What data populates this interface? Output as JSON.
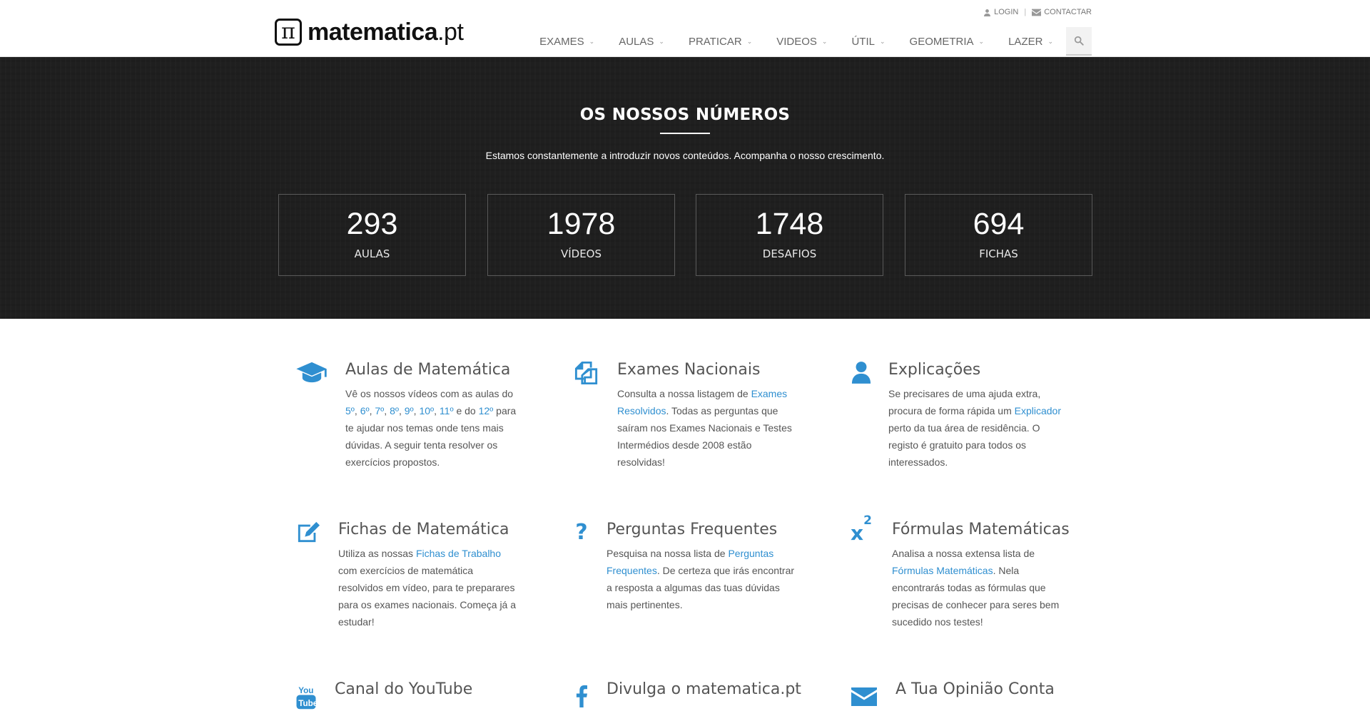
{
  "header": {
    "logo_symbol": "π",
    "logo_brand": "matematica",
    "logo_tld": ".pt",
    "topbar": {
      "login": "LOGIN",
      "separator": "|",
      "contact": "CONTACTAR"
    },
    "nav": [
      {
        "label": "EXAMES"
      },
      {
        "label": "AULAS"
      },
      {
        "label": "PRATICAR"
      },
      {
        "label": "VIDEOS"
      },
      {
        "label": "ÚTIL"
      },
      {
        "label": "GEOMETRIA"
      },
      {
        "label": "LAZER"
      }
    ],
    "search_icon": "search-icon"
  },
  "numbers": {
    "title": "OS NOSSOS NÚMEROS",
    "subtitle": "Estamos constantemente a introduzir novos conteúdos. Acompanha o nosso crescimento.",
    "stats": [
      {
        "value": "293",
        "label": "AULAS"
      },
      {
        "value": "1978",
        "label": "VÍDEOS"
      },
      {
        "value": "1748",
        "label": "DESAFIOS"
      },
      {
        "value": "694",
        "label": "FICHAS"
      }
    ]
  },
  "features": {
    "aulas": {
      "icon": "graduation-cap-icon",
      "title": "Aulas de Matemática",
      "t1": "Vê os nossos vídeos com as aulas do ",
      "links": [
        "5º",
        "6º",
        "7º",
        "8º",
        "9º",
        "10º",
        "11º"
      ],
      "sep": ", ",
      "and": " e do ",
      "link_last": "12º",
      "t2": " para te ajudar nos temas onde tens mais dúvidas. A seguir tenta resolver os exercícios propostos."
    },
    "exames": {
      "icon": "files-icon",
      "title": "Exames Nacionais",
      "t1": "Consulta a nossa listagem de ",
      "link": "Exames Resolvidos",
      "t2": ". Todas as perguntas que saíram nos Exames Nacionais e Testes Intermédios desde 2008 estão resolvidas!"
    },
    "explicacoes": {
      "icon": "user-icon",
      "title": "Explicações",
      "t1": "Se precisares de uma ajuda extra, procura de forma rápida um ",
      "link": "Explicador",
      "t2": " perto da tua área de residência. O registo é gratuito para todos os interessados."
    },
    "fichas": {
      "icon": "edit-icon",
      "title": "Fichas de Matemática",
      "t1": "Utiliza as nossas ",
      "link": "Fichas de Trabalho",
      "t2": " com exercícios de matemática resolvidos em vídeo, para te preparares para os exames nacionais. Começa já a estudar!"
    },
    "perguntas": {
      "icon": "question-icon",
      "title": "Perguntas Frequentes",
      "t1": "Pesquisa na nossa lista de ",
      "link": "Perguntas Frequentes",
      "t2": ". De certeza que irás encontrar a resposta a algumas das tuas dúvidas mais pertinentes."
    },
    "formulas": {
      "icon": "superscript-icon",
      "title": "Fórmulas Matemáticas",
      "t1": "Analisa a nossa extensa lista de ",
      "link": "Fórmulas Matemáticas",
      "t2": ". Nela encontrarás todas as fórmulas que precisas de conhecer para seres bem sucedido nos testes!"
    },
    "youtube": {
      "icon": "youtube-icon",
      "title": "Canal do YouTube"
    },
    "divulga": {
      "icon": "facebook-icon",
      "title": "Divulga o matematica.pt"
    },
    "opiniao": {
      "icon": "envelope-icon",
      "title": "A Tua Opinião Conta"
    }
  },
  "colors": {
    "accent": "#2f8fd0",
    "hero_bg": "#1f1f1f",
    "text": "#555555"
  }
}
